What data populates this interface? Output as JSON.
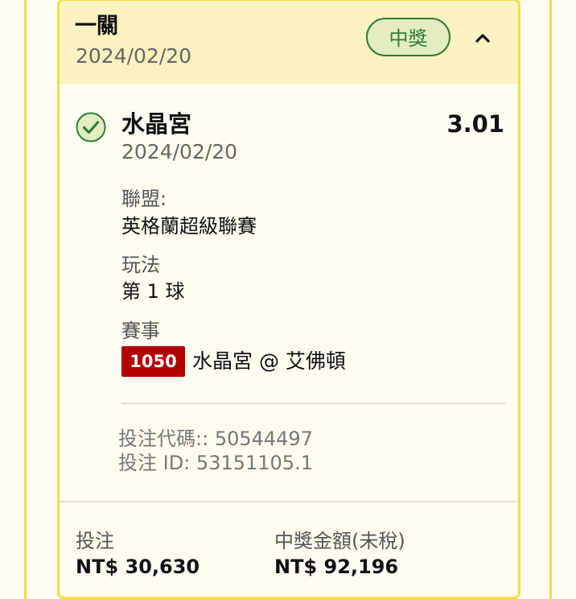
{
  "ticket": {
    "type_title": "一關",
    "date": "2024/02/20",
    "status_badge": "中獎",
    "status_color": "#2e7d32",
    "accent_color": "#f5dd45",
    "collapse_icon": "chevron-up-icon"
  },
  "selection": {
    "status_icon": "check-circle-icon",
    "name": "水晶宮",
    "odds": "3.01",
    "date": "2024/02/20",
    "league_label": "聯盟:",
    "league": "英格蘭超級聯賽",
    "market_label": "玩法",
    "market": "第 1 球",
    "event_label": "賽事",
    "event_code": "1050",
    "event_code_color": "#b30000",
    "event_name": "水晶宮 @ 艾佛頓"
  },
  "codes": {
    "bet_code_label": "投注代碼:",
    "bet_code": "50544497",
    "bet_id_label": "投注 ID:",
    "bet_id": "53151105.1"
  },
  "footer": {
    "stake_label": "投注",
    "stake_value": "NT$ 30,630",
    "payout_label": "中獎金額(未稅)",
    "payout_value": "NT$ 92,196"
  }
}
